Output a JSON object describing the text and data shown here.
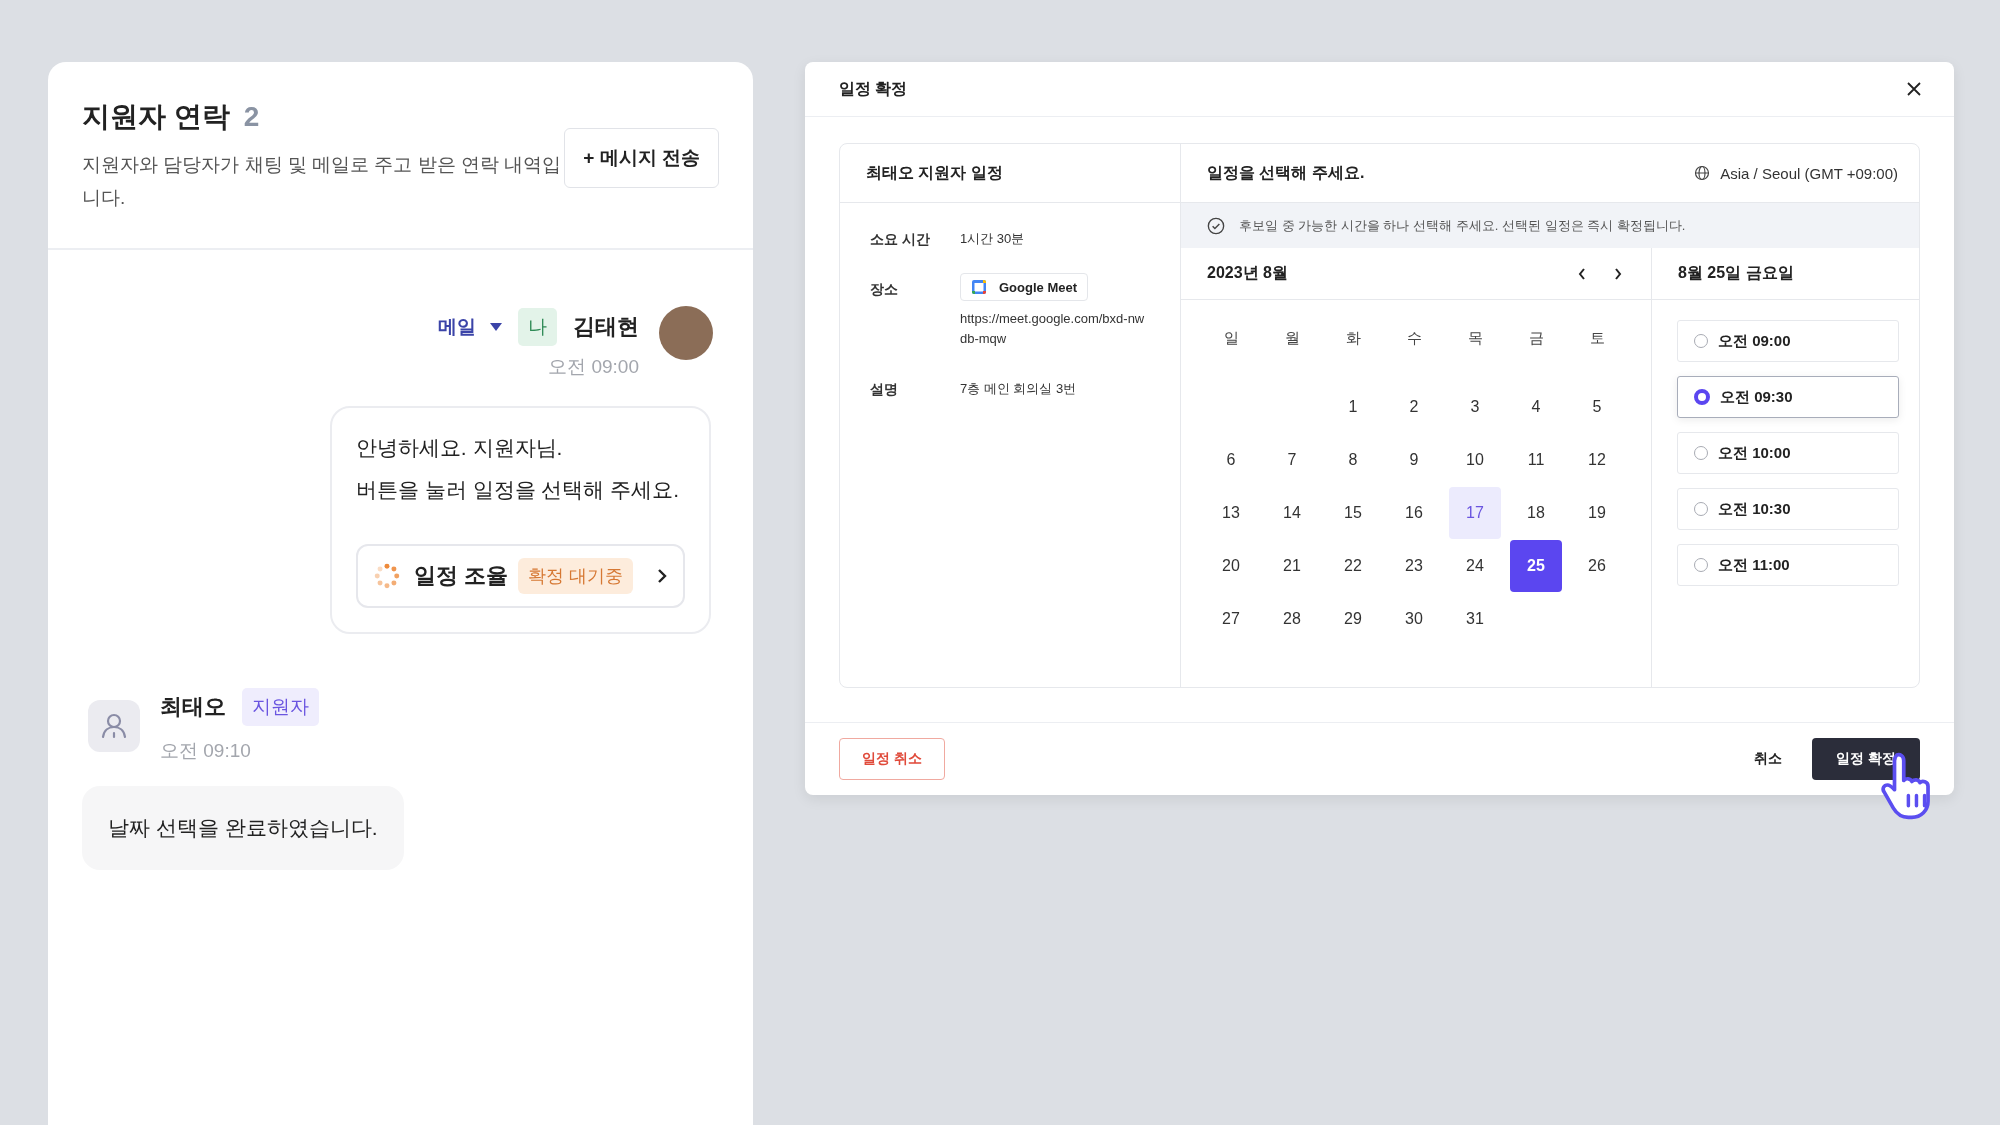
{
  "contact_panel": {
    "title": "지원자 연락",
    "count": "2",
    "description": "지원자와 담당자가 채팅 및 메일로 주고 받은 연락 내역입니다.",
    "send_button": "+ 메시지 전송"
  },
  "messages": [
    {
      "kind": "outgoing",
      "channel": "메일",
      "me_badge": "나",
      "sender": "김태현",
      "time": "오전 09:00",
      "lines": [
        "안녕하세요. 지원자님.",
        "버튼을 눌러 일정을 선택해 주세요."
      ],
      "action": {
        "label": "일정 조율",
        "status": "확정 대기중"
      }
    },
    {
      "kind": "incoming",
      "sender": "최태오",
      "role_badge": "지원자",
      "time": "오전 09:10",
      "lines": [
        "날짜 선택을 완료하였습니다."
      ]
    }
  ],
  "modal": {
    "title": "일정 확정",
    "applicant_schedule": {
      "title": "최태오 지원자 일정",
      "fields": [
        {
          "kind": "text",
          "label": "소요 시간",
          "value": "1시간 30분"
        },
        {
          "kind": "location",
          "label": "장소",
          "chip": "Google Meet",
          "value": "https://meet.google.com/bxd-nwdb-mqw"
        },
        {
          "kind": "text",
          "label": "설명",
          "value": "7층 메인 회의실 3번"
        }
      ]
    },
    "picker_title": "일정을 선택해 주세요.",
    "timezone": "Asia / Seoul (GMT +09:00)",
    "notice": "후보일 중 가능한 시간을 하나 선택해 주세요. 선택된 일정은 즉시 확정됩니다.",
    "month": "2023년 8월",
    "weekdays": [
      "일",
      "월",
      "화",
      "수",
      "목",
      "금",
      "토"
    ],
    "days": [
      {
        "kind": "blank"
      },
      {
        "kind": "blank"
      },
      {
        "kind": "day",
        "label": "1",
        "selected": false,
        "candidate": false
      },
      {
        "kind": "day",
        "label": "2",
        "selected": false,
        "candidate": false
      },
      {
        "kind": "day",
        "label": "3",
        "selected": false,
        "candidate": false
      },
      {
        "kind": "day",
        "label": "4",
        "selected": false,
        "candidate": false
      },
      {
        "kind": "day",
        "label": "5",
        "selected": false,
        "candidate": false
      },
      {
        "kind": "day",
        "label": "6",
        "selected": false,
        "candidate": false
      },
      {
        "kind": "day",
        "label": "7",
        "selected": false,
        "candidate": false
      },
      {
        "kind": "day",
        "label": "8",
        "selected": false,
        "candidate": false
      },
      {
        "kind": "day",
        "label": "9",
        "selected": false,
        "candidate": false
      },
      {
        "kind": "day",
        "label": "10",
        "selected": false,
        "candidate": false
      },
      {
        "kind": "day",
        "label": "11",
        "selected": false,
        "candidate": false
      },
      {
        "kind": "day",
        "label": "12",
        "selected": false,
        "candidate": false
      },
      {
        "kind": "day",
        "label": "13",
        "selected": false,
        "candidate": false
      },
      {
        "kind": "day",
        "label": "14",
        "selected": false,
        "candidate": false
      },
      {
        "kind": "day",
        "label": "15",
        "selected": false,
        "candidate": false
      },
      {
        "kind": "day",
        "label": "16",
        "selected": false,
        "candidate": false
      },
      {
        "kind": "day",
        "label": "17",
        "selected": false,
        "candidate": true
      },
      {
        "kind": "day",
        "label": "18",
        "selected": false,
        "candidate": false
      },
      {
        "kind": "day",
        "label": "19",
        "selected": false,
        "candidate": false
      },
      {
        "kind": "day",
        "label": "20",
        "selected": false,
        "candidate": false
      },
      {
        "kind": "day",
        "label": "21",
        "selected": false,
        "candidate": false
      },
      {
        "kind": "day",
        "label": "22",
        "selected": false,
        "candidate": false
      },
      {
        "kind": "day",
        "label": "23",
        "selected": false,
        "candidate": false
      },
      {
        "kind": "day",
        "label": "24",
        "selected": false,
        "candidate": false
      },
      {
        "kind": "day",
        "label": "25",
        "selected": true,
        "candidate": false
      },
      {
        "kind": "day",
        "label": "26",
        "selected": false,
        "candidate": false
      },
      {
        "kind": "day",
        "label": "27",
        "selected": false,
        "candidate": false
      },
      {
        "kind": "day",
        "label": "28",
        "selected": false,
        "candidate": false
      },
      {
        "kind": "day",
        "label": "29",
        "selected": false,
        "candidate": false
      },
      {
        "kind": "day",
        "label": "30",
        "selected": false,
        "candidate": false
      },
      {
        "kind": "day",
        "label": "31",
        "selected": false,
        "candidate": false
      }
    ],
    "selected_date": "8월 25일 금요일",
    "time_slots": [
      {
        "label": "오전 09:00",
        "selected": false
      },
      {
        "label": "오전 09:30",
        "selected": true
      },
      {
        "label": "오전 10:00",
        "selected": false
      },
      {
        "label": "오전 10:30",
        "selected": false
      },
      {
        "label": "오전 11:00",
        "selected": false
      }
    ],
    "cancel_schedule_button": "일정 취소",
    "cancel_button": "취소",
    "confirm_button": "일정 확정"
  }
}
